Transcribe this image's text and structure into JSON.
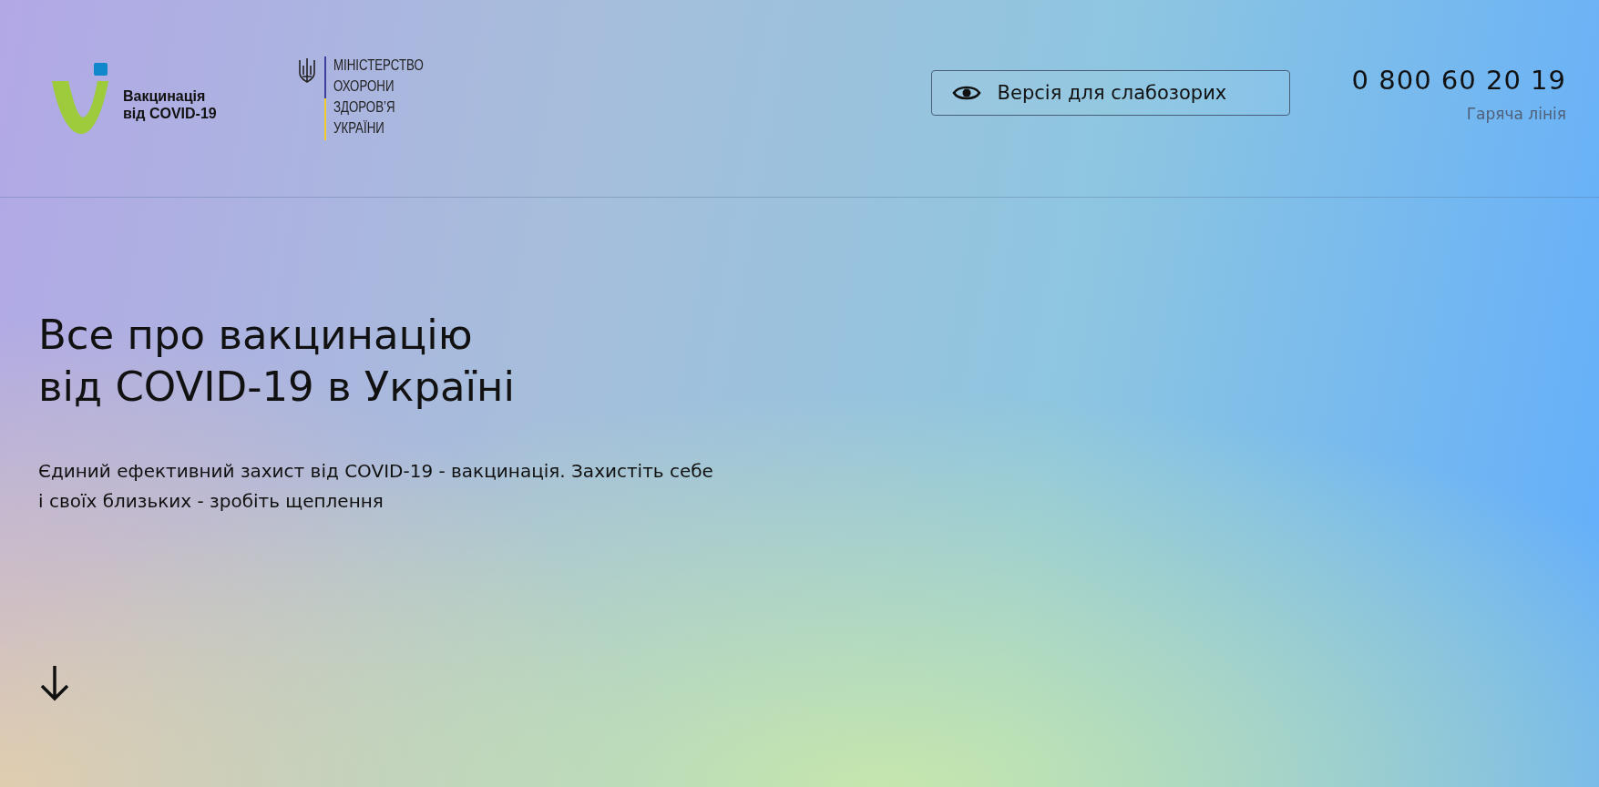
{
  "header": {
    "logo_text": [
      "Вакцинація",
      "від COVID-19"
    ],
    "ministry_text": [
      "МІНІСТЕРСТВО",
      "ОХОРОНИ",
      "ЗДОРОВ’Я",
      "УКРАЇНИ"
    ],
    "accessibility_button": "Версія для слабозорих",
    "hotline": {
      "phone": "0 800 60 20 19",
      "label": "Гаряча лінія"
    }
  },
  "hero": {
    "title": [
      "Все про вакцинацію",
      "від COVID-19 в Україні"
    ],
    "subtitle": [
      "Єдиний ефективний захист від COVID-19 - вакцинація. Захистіть себе",
      "і своїх близьких - зробіть щеплення"
    ]
  }
}
